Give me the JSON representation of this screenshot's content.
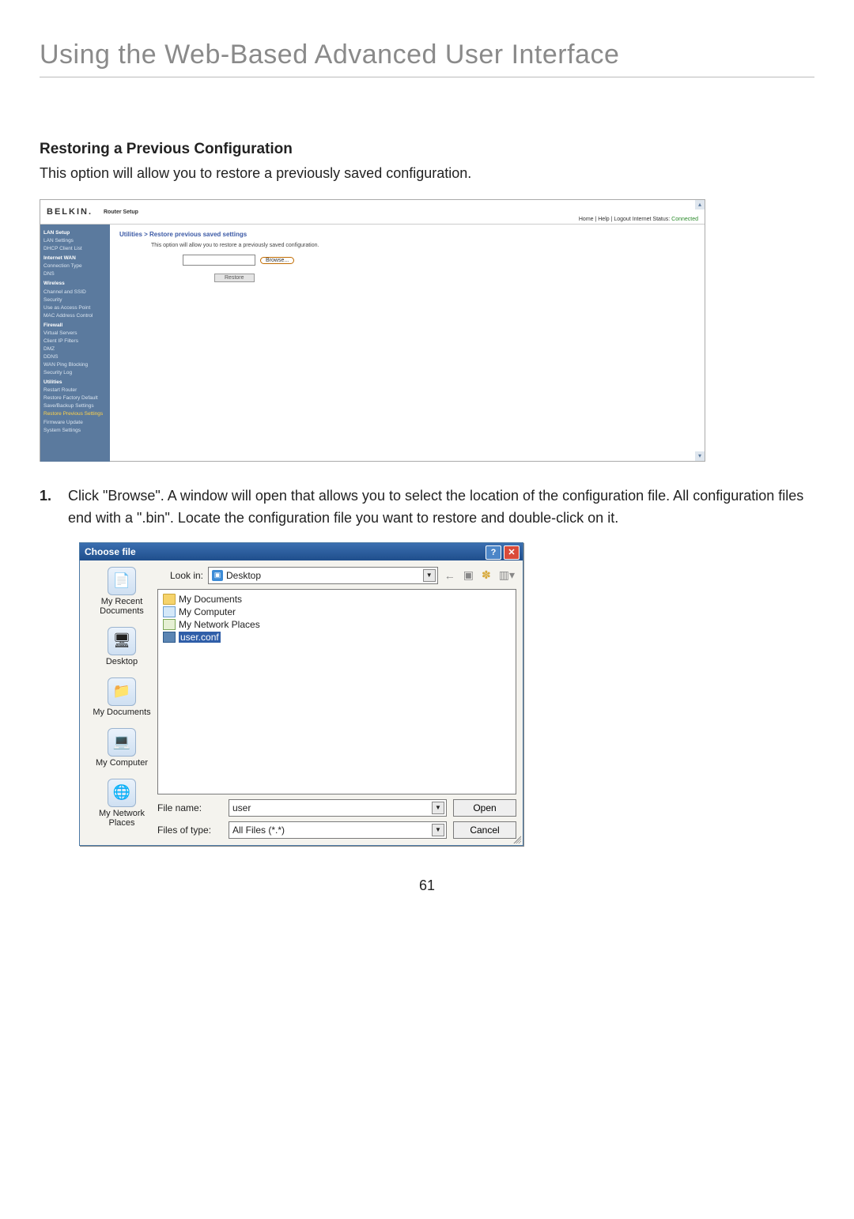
{
  "page": {
    "title": "Using the Web-Based Advanced User Interface",
    "number": "61"
  },
  "section": {
    "heading": "Restoring a Previous Configuration",
    "description": "This option will allow you to restore a previously saved configuration."
  },
  "router": {
    "brand": "BELKIN.",
    "setup_label": "Router Setup",
    "top_links": "Home | Help | Logout   Internet Status: ",
    "status": "Connected",
    "sidebar": {
      "items": [
        {
          "t": "LAN Setup",
          "cat": true
        },
        {
          "t": "LAN Settings"
        },
        {
          "t": "DHCP Client List"
        },
        {
          "t": "Internet WAN",
          "cat": true
        },
        {
          "t": "Connection Type"
        },
        {
          "t": "DNS"
        },
        {
          "t": "Wireless",
          "cat": true
        },
        {
          "t": "Channel and SSID"
        },
        {
          "t": "Security"
        },
        {
          "t": "Use as Access Point"
        },
        {
          "t": "MAC Address Control"
        },
        {
          "t": "Firewall",
          "cat": true
        },
        {
          "t": "Virtual Servers"
        },
        {
          "t": "Client IP Filters"
        },
        {
          "t": "DMZ"
        },
        {
          "t": "DDNS"
        },
        {
          "t": "WAN Ping Blocking"
        },
        {
          "t": "Security Log"
        },
        {
          "t": "Utilities",
          "cat": true
        },
        {
          "t": "Restart Router"
        },
        {
          "t": "Restore Factory Default"
        },
        {
          "t": "Save/Backup Settings"
        },
        {
          "t": "Restore Previous Settings",
          "sel": true
        },
        {
          "t": "Firmware Update"
        },
        {
          "t": "System Settings"
        }
      ]
    },
    "crumb": "Utilities > Restore previous saved settings",
    "note": "This option will allow you to restore a previously saved configuration.",
    "browse_btn": "Browse...",
    "restore_btn": "Restore"
  },
  "step": {
    "num": "1.",
    "text": "Click \"Browse\". A window will open that allows you to select the location of the configuration file. All configuration files end with a \".bin\". Locate the configuration file you want to restore and double-click on it."
  },
  "dialog": {
    "title": "Choose file",
    "lookin_label": "Look in:",
    "lookin_value": "Desktop",
    "places": [
      {
        "label": "My Recent Documents",
        "glyph": "📄"
      },
      {
        "label": "Desktop",
        "glyph": "🖥"
      },
      {
        "label": "My Documents",
        "glyph": "📁"
      },
      {
        "label": "My Computer",
        "glyph": "💻"
      },
      {
        "label": "My Network Places",
        "glyph": "🌐"
      }
    ],
    "files": [
      {
        "label": "My Documents",
        "type": "folder"
      },
      {
        "label": "My Computer",
        "type": "computer"
      },
      {
        "label": "My Network Places",
        "type": "network"
      },
      {
        "label": "user.conf",
        "type": "file",
        "selected": true
      }
    ],
    "filename_label": "File name:",
    "filename_value": "user",
    "filetype_label": "Files of type:",
    "filetype_value": "All Files (*.*)",
    "open_btn": "Open",
    "cancel_btn": "Cancel"
  }
}
